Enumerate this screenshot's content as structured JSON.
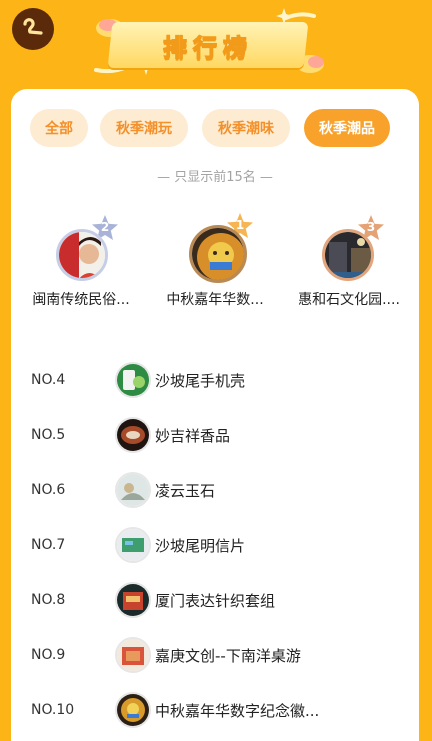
{
  "header": {
    "title": "排行榜",
    "back_icon": "back-arrow-icon"
  },
  "tabs": [
    {
      "label": "全部",
      "active": false
    },
    {
      "label": "秋季潮玩",
      "active": false
    },
    {
      "label": "秋季潮味",
      "active": false
    },
    {
      "label": "秋季潮品",
      "active": true
    }
  ],
  "hint": "— 只显示前15名 —",
  "podium": [
    {
      "rank": "2",
      "name": "闽南传统民俗..."
    },
    {
      "rank": "1",
      "name": "中秋嘉年华数..."
    },
    {
      "rank": "3",
      "name": "惠和石文化园...."
    }
  ],
  "list": [
    {
      "rank": "NO.4",
      "name": "沙坡尾手机壳"
    },
    {
      "rank": "NO.5",
      "name": "妙吉祥香品"
    },
    {
      "rank": "NO.6",
      "name": "凌云玉石"
    },
    {
      "rank": "NO.7",
      "name": "沙坡尾明信片"
    },
    {
      "rank": "NO.8",
      "name": "厦门表达针织套组"
    },
    {
      "rank": "NO.9",
      "name": "嘉庚文创--下南洋桌游"
    },
    {
      "rank": "NO.10",
      "name": "中秋嘉年华数字纪念徽..."
    }
  ],
  "colors": {
    "background": "#fcb417",
    "accent": "#f8a22c",
    "tab_inactive_bg": "#fdebd2",
    "tab_inactive_text": "#f3902a"
  }
}
